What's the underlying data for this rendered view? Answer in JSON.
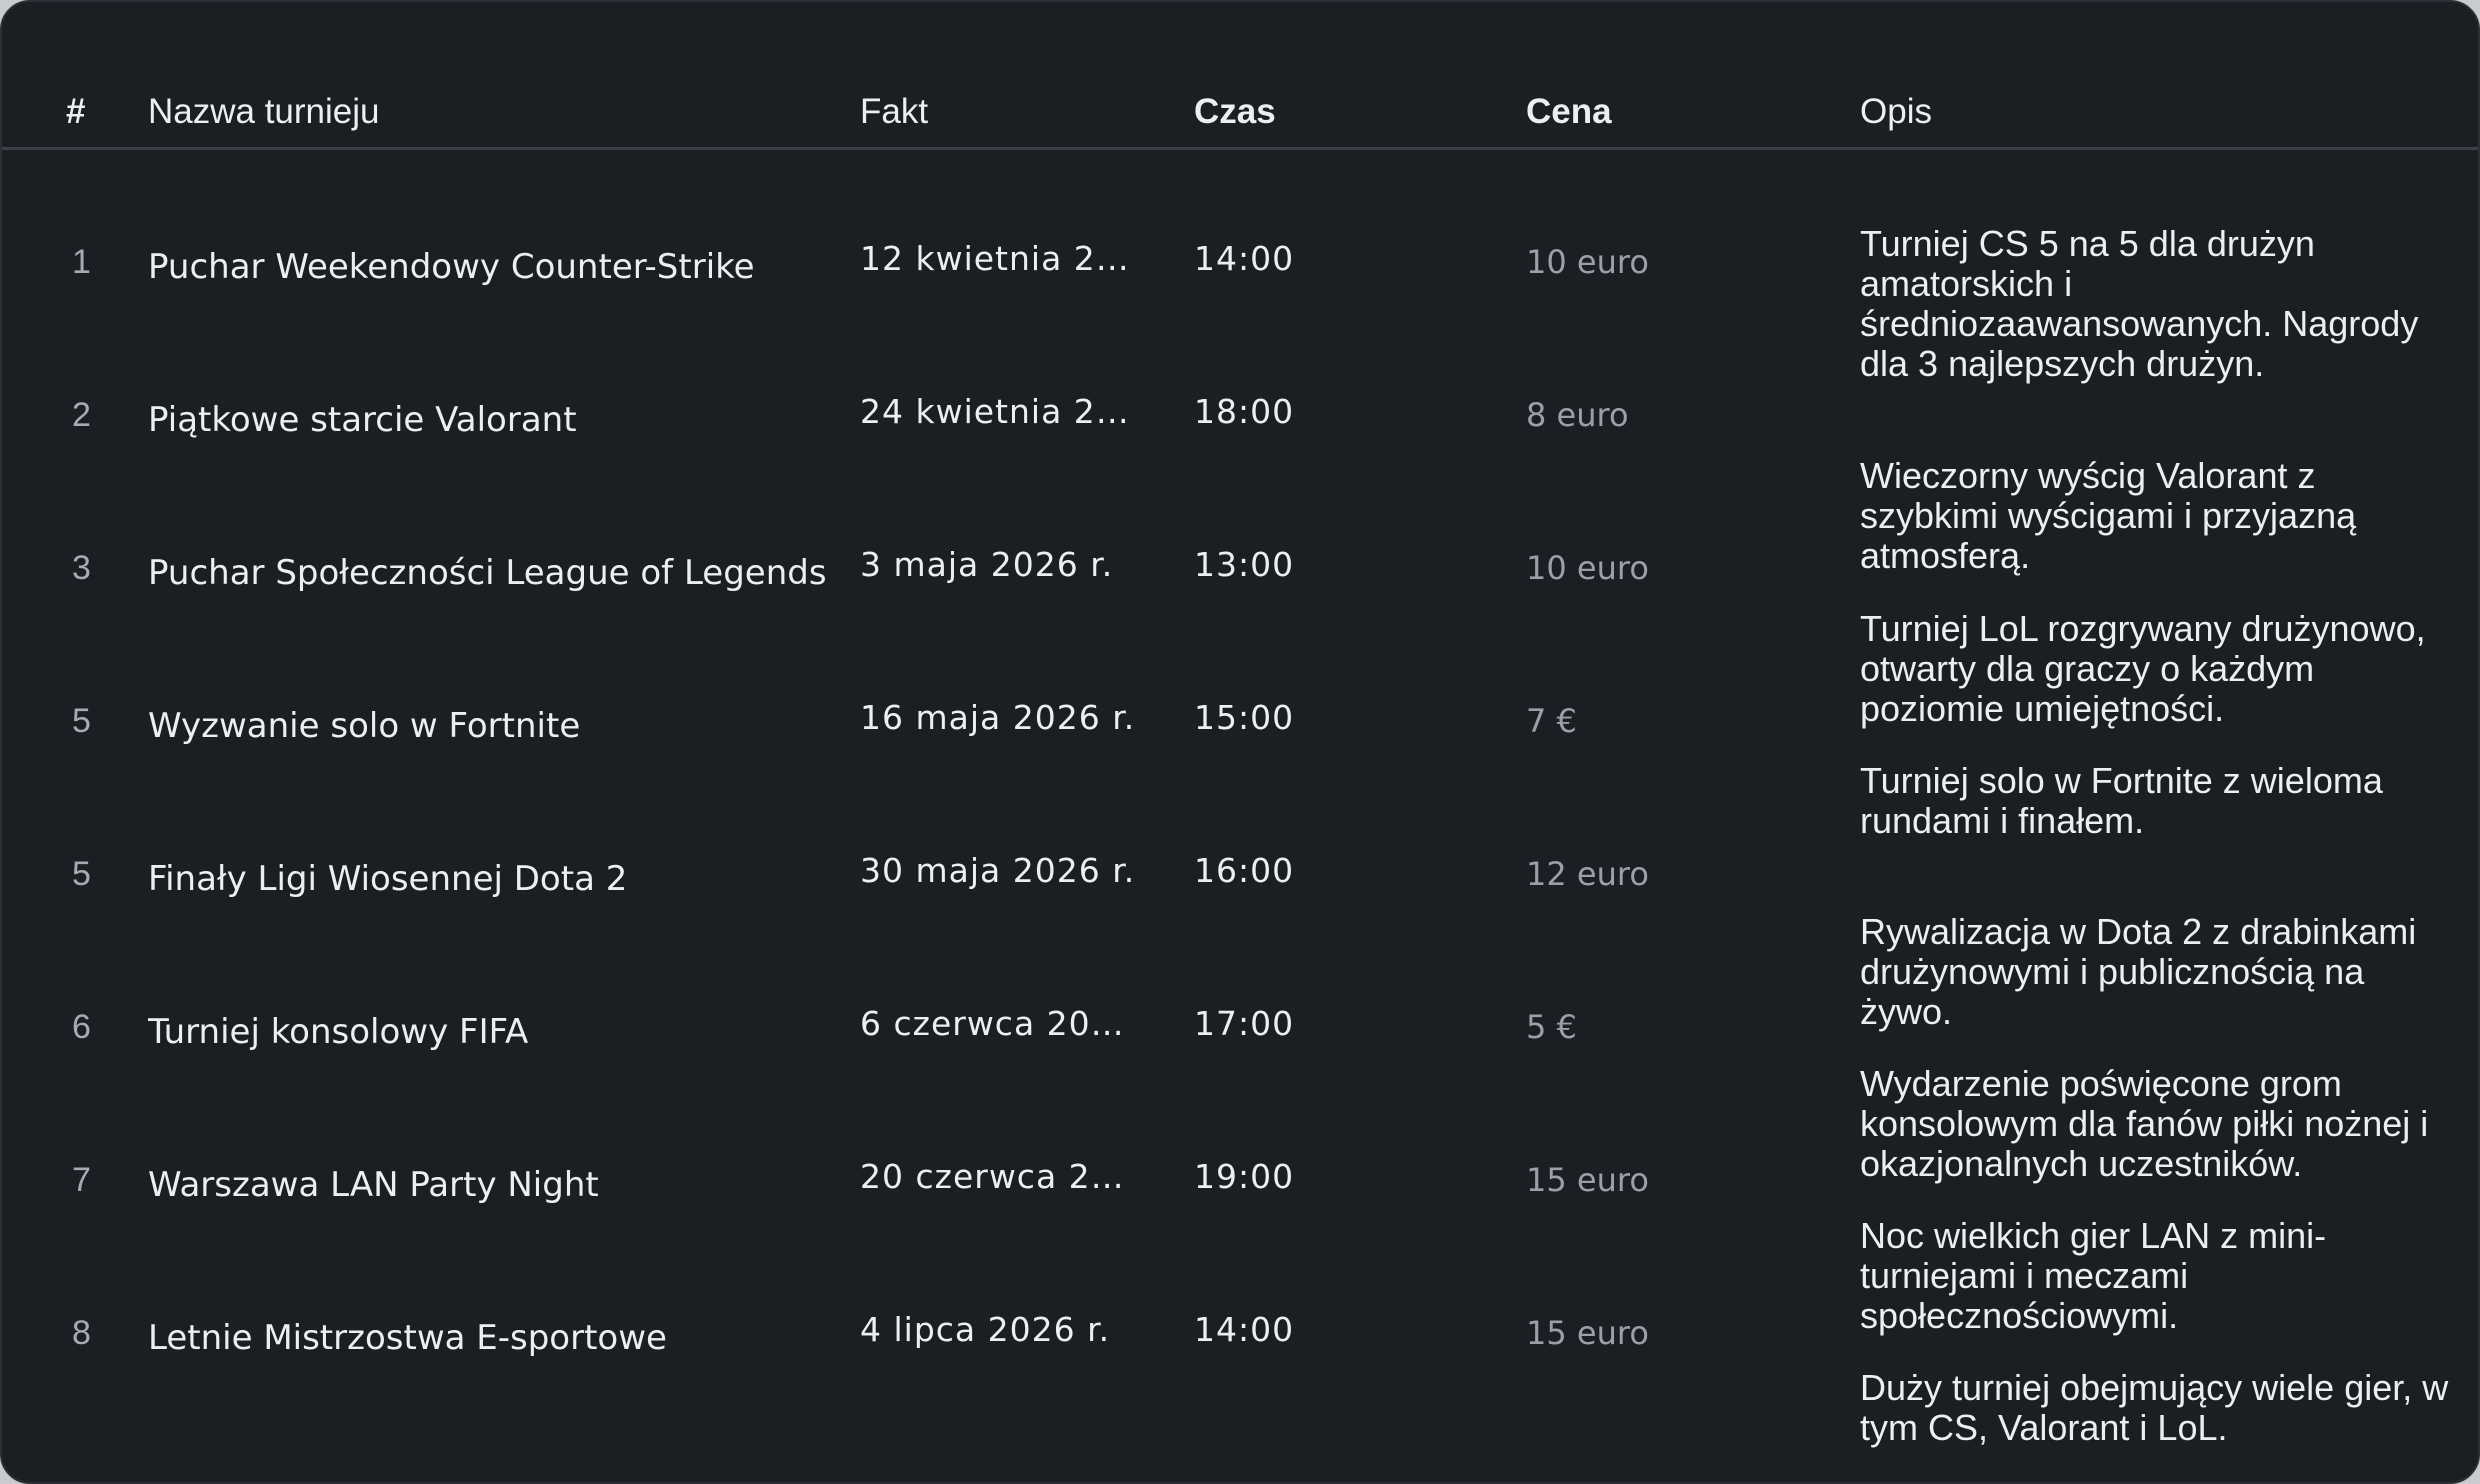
{
  "headers": {
    "num": "#",
    "name": "Nazwa turnieju",
    "date": "Fakt",
    "time": "Czas",
    "price": "Cena",
    "desc": "Opis"
  },
  "rows": [
    {
      "num": "1",
      "name": "Puchar Weekendowy Counter-Strike",
      "date": "12 kwietnia 20…",
      "time": "14:00",
      "price": "10 euro"
    },
    {
      "num": "2",
      "name": "Piątkowe starcie Valorant",
      "date": "24 kwietnia 20…",
      "time": "18:00",
      "price": "8 euro"
    },
    {
      "num": "3",
      "name": "Puchar Społeczności League of Legends",
      "date": "3 maja 2026 r.",
      "time": "13:00",
      "price": "10 euro"
    },
    {
      "num": "5",
      "name": "Wyzwanie solo w Fortnite",
      "date": "16 maja 2026 r.",
      "time": "15:00",
      "price": "7 €"
    },
    {
      "num": "5",
      "name": "Finały Ligi Wiosennej Dota 2",
      "date": "30 maja 2026 r.",
      "time": "16:00",
      "price": "12 euro"
    },
    {
      "num": "6",
      "name": "Turniej konsolowy FIFA",
      "date": "6 czerwca 202…",
      "time": "17:00",
      "price": "5 €"
    },
    {
      "num": "7",
      "name": "Warszawa LAN Party Night",
      "date": "20 czerwca 20…",
      "time": "19:00",
      "price": "15 euro"
    },
    {
      "num": "8",
      "name": "Letnie Mistrzostwa E-sportowe",
      "date": "4 lipca 2026 r.",
      "time": "14:00",
      "price": "15 euro"
    }
  ],
  "descriptions": [
    "Turniej CS 5 na 5 dla drużyn amatorskich i średniozaawansowanych. Nagrody dla 3 najlepszych drużyn.",
    "Wieczorny wyścig Valorant z szybkimi wyścigami i przyjazną atmosferą.",
    "Turniej LoL rozgrywany drużynowo, otwarty dla graczy o każdym poziomie umiejętności.",
    "Turniej solo w Fortnite z wieloma rundami i finałem.",
    "Rywalizacja w Dota 2 z drabinkami drużynowymi i publicznością na żywo.",
    "Wydarzenie poświęcone grom konsolowym dla fanów piłki nożnej i okazjonalnych uczestników.",
    "Noc wielkich gier LAN z mini-turniejami i meczami społecznościowymi.",
    "Duży turniej obejmujący wiele gier, w tym CS, Valorant i LoL."
  ]
}
